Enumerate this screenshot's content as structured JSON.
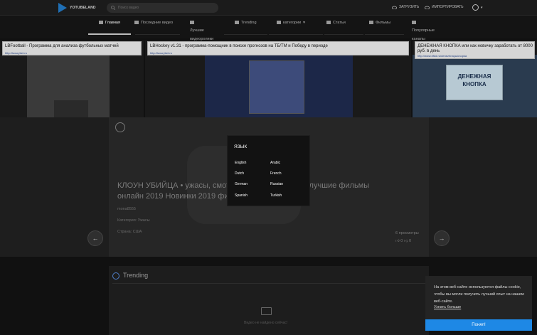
{
  "header": {
    "logo_text": "YOTUBELAND",
    "search_placeholder": "Поиск видео",
    "upload_label": "ЗАГРУЗИТЬ",
    "import_label": "ИМПОРТИРОВАТЬ"
  },
  "nav": {
    "items": [
      {
        "label": "Главная",
        "icon": "home-icon"
      },
      {
        "label": "Последние видео",
        "icon": "video-icon"
      },
      {
        "label": "Лучшие видеоролики",
        "icon": "chart-icon"
      },
      {
        "label": "Trending",
        "icon": "trending-icon"
      },
      {
        "label": "категории",
        "icon": "tag-icon"
      },
      {
        "label": "Статьи",
        "icon": "article-icon"
      },
      {
        "label": "Фильмы",
        "icon": "film-icon"
      },
      {
        "label": "Популярные каналы",
        "icon": "channels-icon"
      }
    ]
  },
  "ads": [
    {
      "title": "LBFootball - Программа для анализа футбольных матчей",
      "url": "http://luxurybet.ru"
    },
    {
      "title": "LBHockey v1.31 - программа-помощник в поиске прогнозов на ТБ/ТМ и Победу в периоде",
      "url": "http://luxurybet.ru"
    },
    {
      "title": "ДЕНЕЖНАЯ КНОПКА или как новичку заработать от 8000 руб. в день",
      "url": "http://www.bfdd.ru/denezhnaya-knopka",
      "image_text": "ДЕНЕЖНАЯ КНОПКА"
    }
  ],
  "hero": {
    "title": "КЛОУН УБИЙЦА • ужасы, смотреть фильмы онлайн лучшие фильмы онлайн 2019 Новинки 2019 фильмы",
    "channel": "mona8555",
    "category": "Категория: Ужасы",
    "country": "Страна: США",
    "views": "6 просмотры",
    "likes": "0",
    "dislikes": "0"
  },
  "language_modal": {
    "title": "ЯЗЫК",
    "languages": [
      "English",
      "Arabic",
      "Dutch",
      "French",
      "German",
      "Russian",
      "Spanish",
      "Turkish"
    ]
  },
  "trending": {
    "title": "Trending",
    "empty_text": "Видео не найдено сейчас!"
  },
  "cookie": {
    "text": "На этом веб-сайте используются файлы cookie, чтобы вы могли получить лучший опыт на нашем веб-сайте.",
    "link": "Узнать больше",
    "button": "Понял!"
  }
}
